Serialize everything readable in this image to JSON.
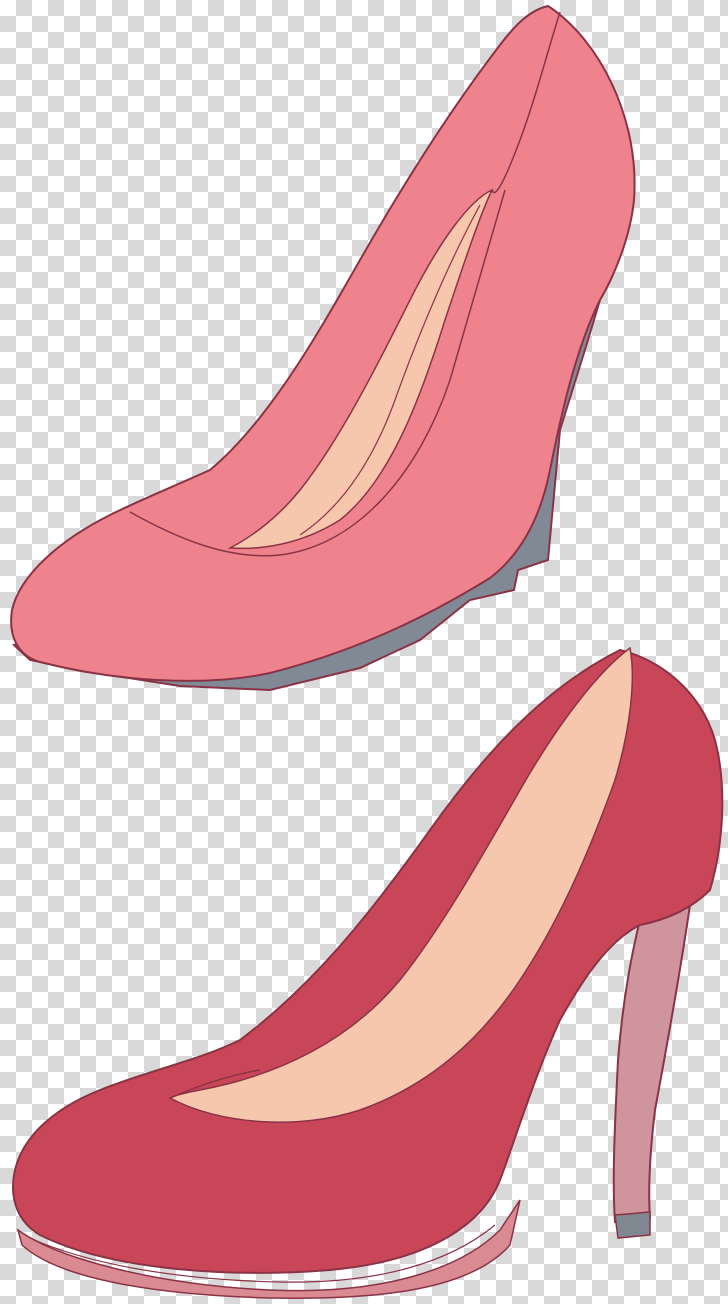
{
  "colors": {
    "checker_light": "#ffffff",
    "checker_dark": "#d9d9d9",
    "wedge_shoe_upper": "#ef838d",
    "wedge_shoe_lining": "#f7c7ad",
    "wedge_shoe_sole": "#818a94",
    "stiletto_upper": "#c94659",
    "stiletto_lining": "#f7c7ad",
    "stiletto_heel": "#cf949e",
    "stiletto_heel_tip": "#7f8790",
    "stiletto_sole": "#d98a92",
    "outline": "#8a3346"
  },
  "objects": [
    {
      "name": "wedge-pump",
      "color_key": "wedge_shoe_upper"
    },
    {
      "name": "stiletto-pump",
      "color_key": "stiletto_upper"
    }
  ]
}
